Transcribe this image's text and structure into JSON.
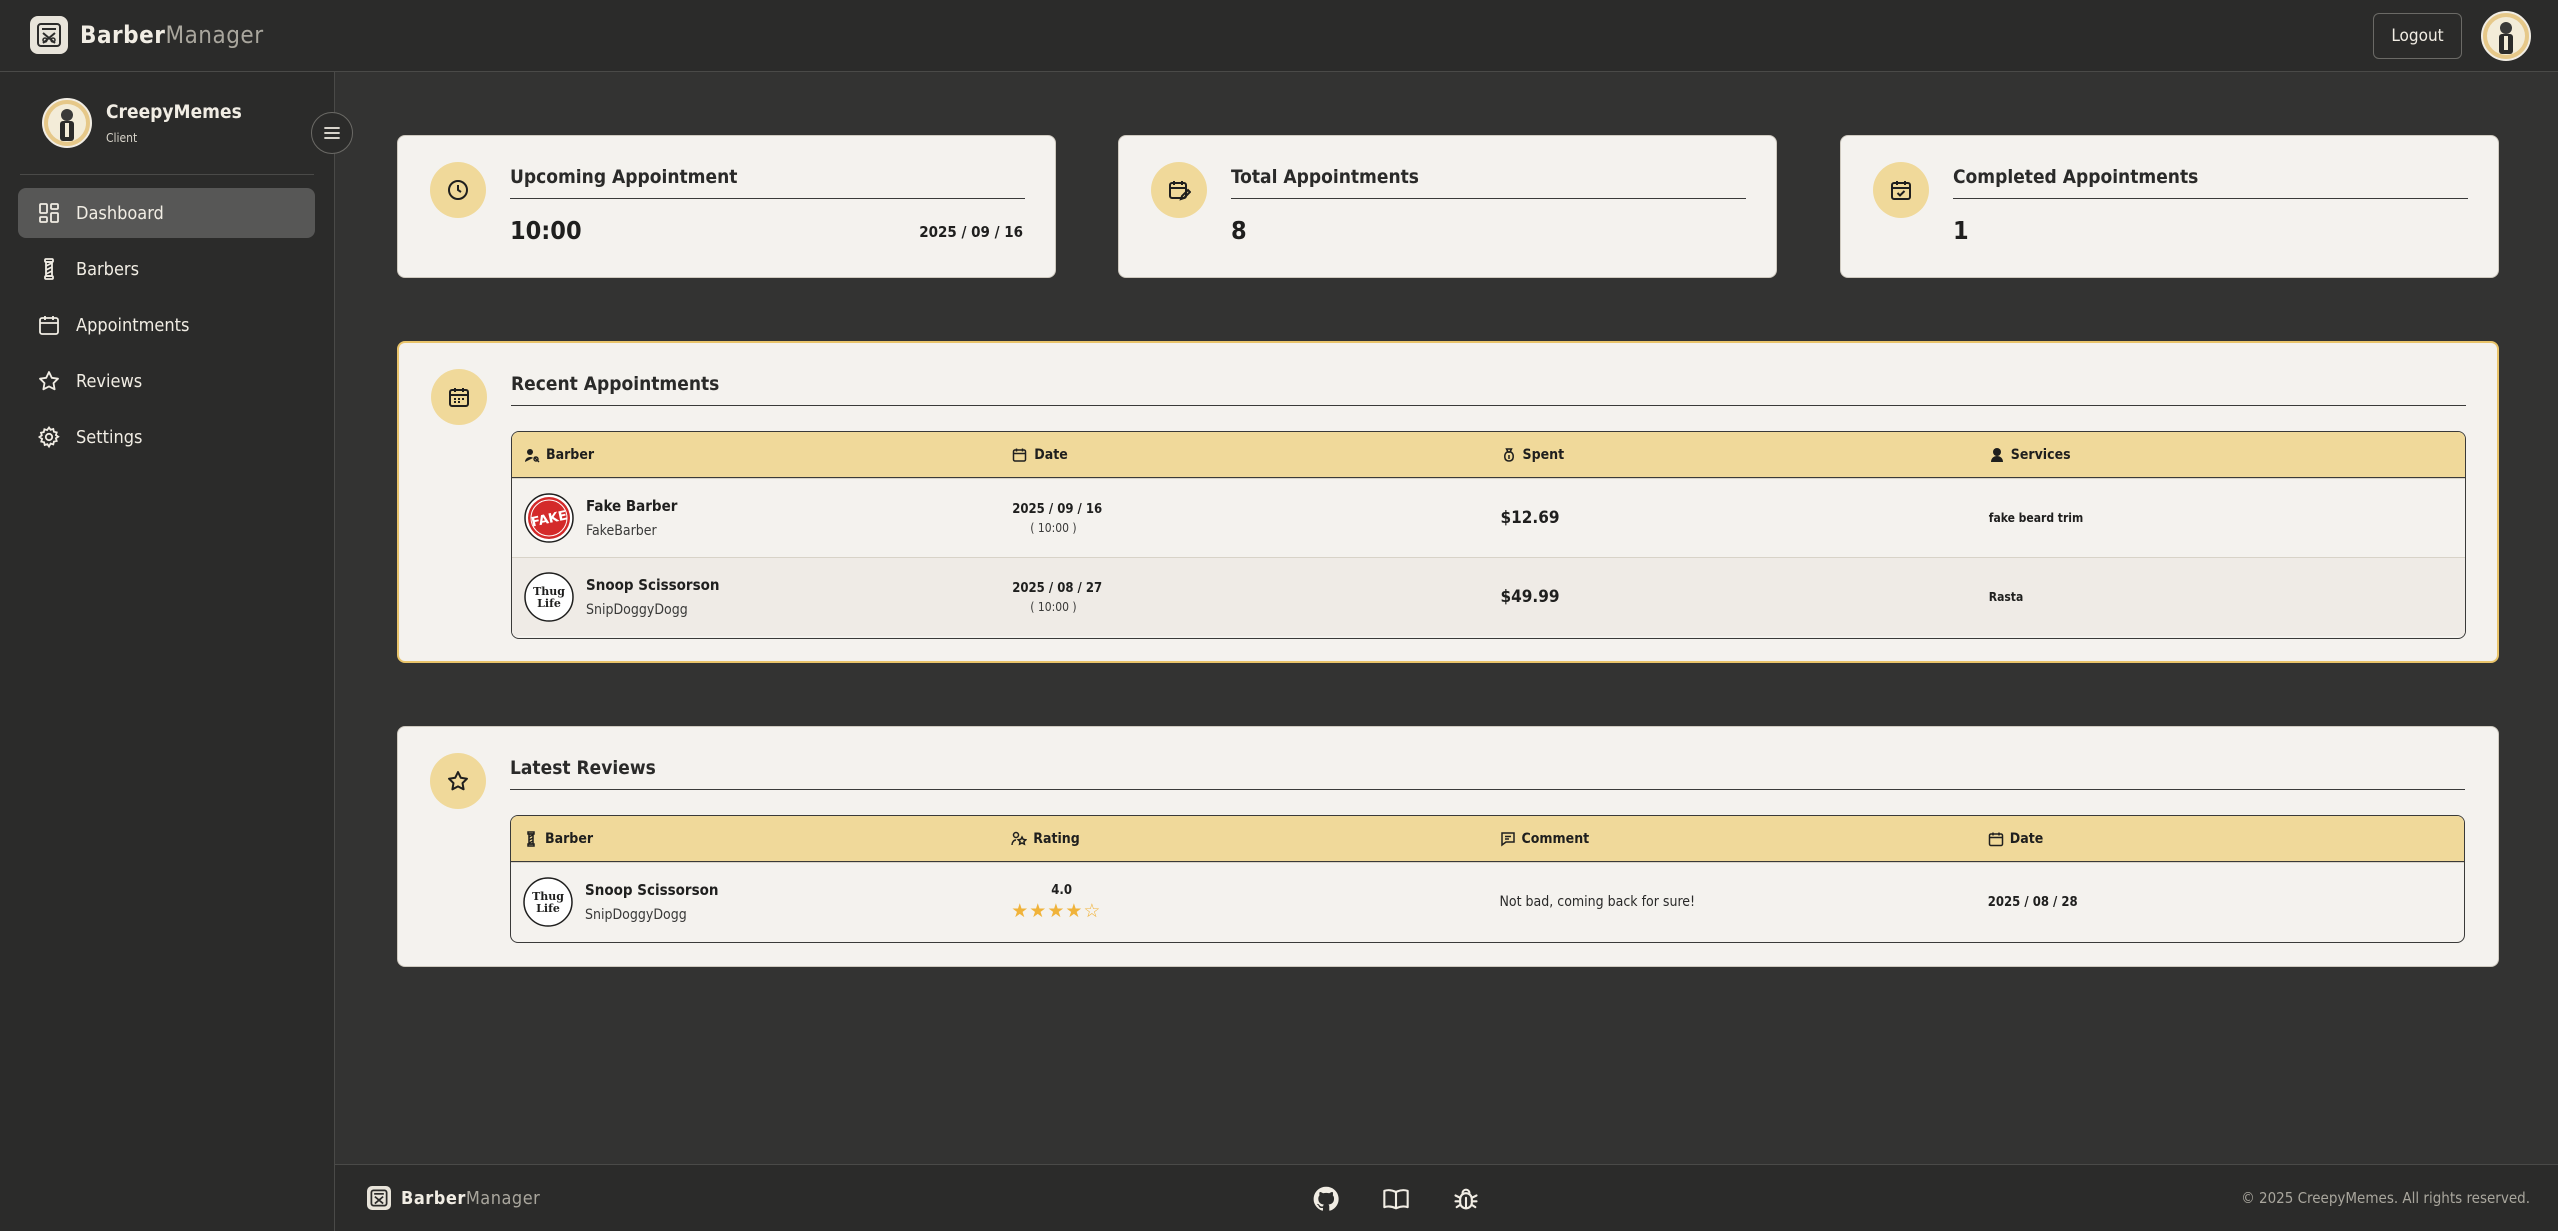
{
  "brand": {
    "name_bold": "Barber",
    "name_light": "Manager"
  },
  "header": {
    "logout_label": "Logout"
  },
  "user": {
    "name": "CreepyMemes",
    "role": "Client"
  },
  "sidebar": {
    "items": [
      {
        "label": "Dashboard",
        "icon": "dashboard-icon",
        "active": true
      },
      {
        "label": "Barbers",
        "icon": "barber-pole-icon"
      },
      {
        "label": "Appointments",
        "icon": "calendar-icon"
      },
      {
        "label": "Reviews",
        "icon": "star-icon"
      },
      {
        "label": "Settings",
        "icon": "gear-icon"
      }
    ]
  },
  "stats": {
    "upcoming": {
      "title": "Upcoming Appointment",
      "value": "10:00",
      "date": "2025 / 09 / 16"
    },
    "total": {
      "title": "Total Appointments",
      "value": "8"
    },
    "completed": {
      "title": "Completed Appointments",
      "value": "1"
    }
  },
  "recent": {
    "title": "Recent Appointments",
    "columns": [
      "Barber",
      "Date",
      "Spent",
      "Services"
    ],
    "rows": [
      {
        "name": "Fake Barber",
        "username": "FakeBarber",
        "avatar_text": "FAKE",
        "date": "2025 / 09 / 16",
        "time": "( 10:00 )",
        "spent": "$12.69",
        "services": "fake beard trim"
      },
      {
        "name": "Snoop Scissorson",
        "username": "SnipDoggyDogg",
        "avatar_text": "Thug Life",
        "date": "2025 / 08 / 27",
        "time": "( 10:00 )",
        "spent": "$49.99",
        "services": "Rasta"
      }
    ]
  },
  "reviews": {
    "title": "Latest Reviews",
    "columns": [
      "Barber",
      "Rating",
      "Comment",
      "Date"
    ],
    "rows": [
      {
        "name": "Snoop Scissorson",
        "username": "SnipDoggyDogg",
        "avatar_text": "Thug Life",
        "rating": "4.0",
        "stars": 4,
        "comment": "Not bad, coming back for sure!",
        "date": "2025 / 08 / 28"
      }
    ]
  },
  "footer": {
    "copyright": "© 2025 CreepyMemes. All rights reserved."
  },
  "colors": {
    "accent": "#f0d99a",
    "highlight_border": "#e9c46a",
    "star": "#f0b33a",
    "bg": "#333332",
    "card": "#f4f2ee"
  }
}
